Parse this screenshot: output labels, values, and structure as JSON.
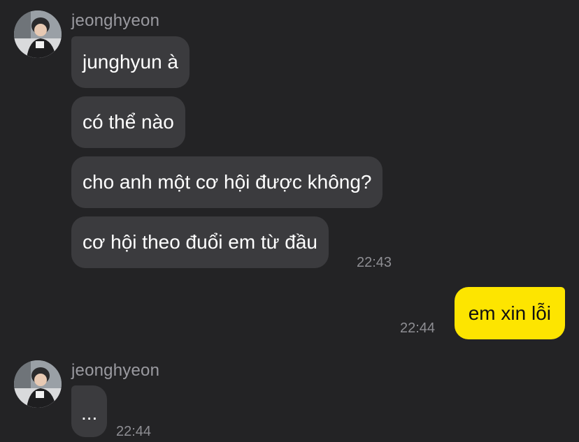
{
  "conversation": {
    "group1": {
      "sender": "jeonghyeon",
      "messages": [
        "junghyun à",
        "có thể nào",
        "cho anh một cơ hội được không?",
        "cơ hội theo đuổi em từ đầu"
      ],
      "time": "22:43"
    },
    "mine": {
      "message": "em xin lỗi",
      "time": "22:44"
    },
    "group2": {
      "sender": "jeonghyeon",
      "message": "...",
      "time": "22:44"
    }
  },
  "colors": {
    "background": "#232325",
    "incoming_bubble": "#3b3b3e",
    "outgoing_bubble": "#fde500",
    "timestamp": "#8e8e93",
    "sender_name": "#9a9aa0"
  }
}
